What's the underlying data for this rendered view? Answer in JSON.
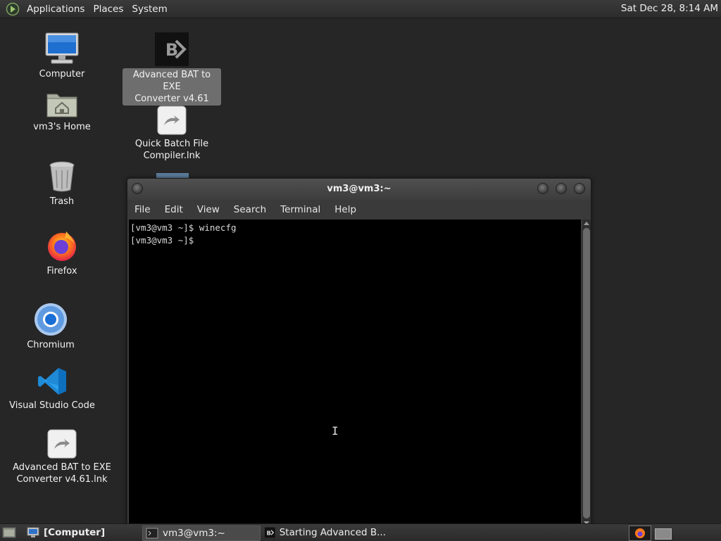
{
  "top_panel": {
    "menus": [
      "Applications",
      "Places",
      "System"
    ],
    "clock": "Sat Dec 28,  8:14 AM"
  },
  "desktop": {
    "computer": "Computer",
    "home": "vm3's Home",
    "trash": "Trash",
    "firefox": "Firefox",
    "chromium": "Chromium",
    "vscode": "Visual Studio Code",
    "bat_lnk": [
      "Advanced BAT to EXE",
      "Converter v4.61.lnk"
    ],
    "bat_app": [
      "Advanced BAT to EXE",
      "Converter v4.61"
    ],
    "quick_batch": [
      "Quick Batch File",
      "Compiler.lnk"
    ]
  },
  "terminal": {
    "title": "vm3@vm3:~",
    "menus": [
      "File",
      "Edit",
      "View",
      "Search",
      "Terminal",
      "Help"
    ],
    "lines": [
      "[vm3@vm3 ~]$ winecfg",
      "[vm3@vm3 ~]$"
    ]
  },
  "taskbar": {
    "computer": "[Computer]",
    "terminal": "vm3@vm3:~",
    "starting": "Starting Advanced B..."
  },
  "colors": {
    "desktop_bg": "#262626",
    "terminal_bg": "#000000",
    "selected_label_bg": "#6e6e6e"
  }
}
